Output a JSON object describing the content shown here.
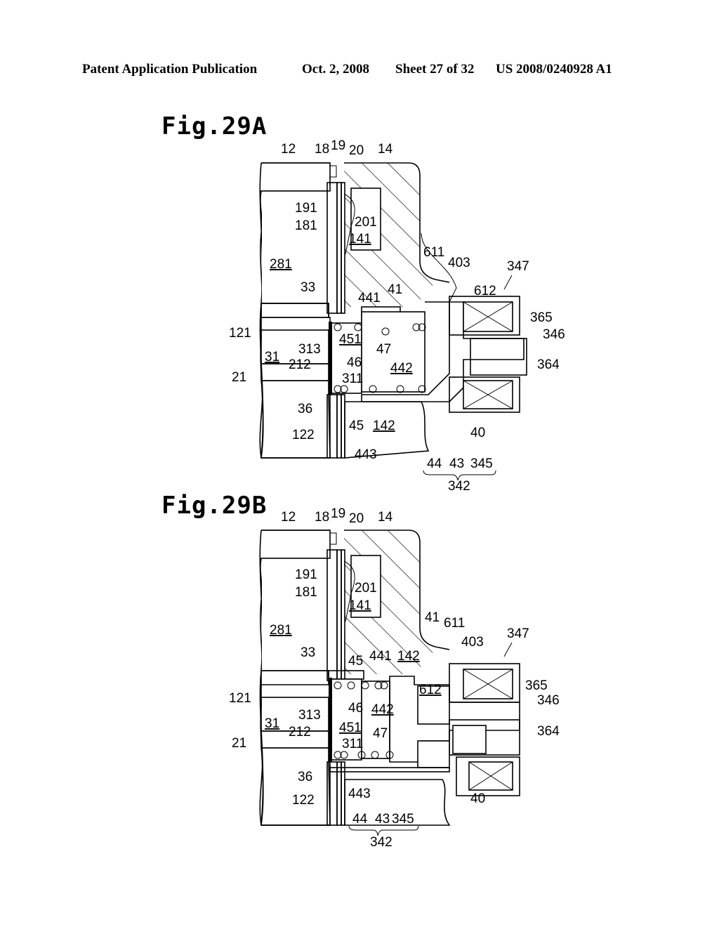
{
  "header": {
    "publication": "Patent Application Publication",
    "date": "Oct. 2, 2008",
    "sheet": "Sheet 27 of 32",
    "patent_number": "US 2008/0240928 A1"
  },
  "figures": [
    {
      "title": "Fig.29A",
      "labels": {
        "l12": "12",
        "l18": "18",
        "l19": "19",
        "l20": "20",
        "l14": "14",
        "l191": "191",
        "l181": "181",
        "l201": "201",
        "l141": "141",
        "l281": "281",
        "l611": "611",
        "l403": "403",
        "l347": "347",
        "l612": "612",
        "l33": "33",
        "l441": "441",
        "l41": "41",
        "l365": "365",
        "l346": "346",
        "l121": "121",
        "l313": "313",
        "l451": "451",
        "l47": "47",
        "l364": "364",
        "l31": "31",
        "l212": "212",
        "l46": "46",
        "l442": "442",
        "l21": "21",
        "l311": "311",
        "l36": "36",
        "l45": "45",
        "l142": "142",
        "l40": "40",
        "l122": "122",
        "l443": "443",
        "l44": "44",
        "l43": "43",
        "l345": "345",
        "l342": "342"
      }
    },
    {
      "title": "Fig.29B",
      "labels": {
        "l12": "12",
        "l18": "18",
        "l19": "19",
        "l20": "20",
        "l14": "14",
        "l191": "191",
        "l181": "181",
        "l201": "201",
        "l141": "141",
        "l281": "281",
        "l41": "41",
        "l611": "611",
        "l403": "403",
        "l347": "347",
        "l33": "33",
        "l45": "45",
        "l441": "441",
        "l142": "142",
        "l612": "612",
        "l365": "365",
        "l346": "346",
        "l121": "121",
        "l313": "313",
        "l46": "46",
        "l442": "442",
        "l31": "31",
        "l451": "451",
        "l364": "364",
        "l212": "212",
        "l47": "47",
        "l21": "21",
        "l311": "311",
        "l36": "36",
        "l40": "40",
        "l443": "443",
        "l122": "122",
        "l44": "44",
        "l43": "43",
        "l345": "345",
        "l342": "342"
      }
    }
  ]
}
